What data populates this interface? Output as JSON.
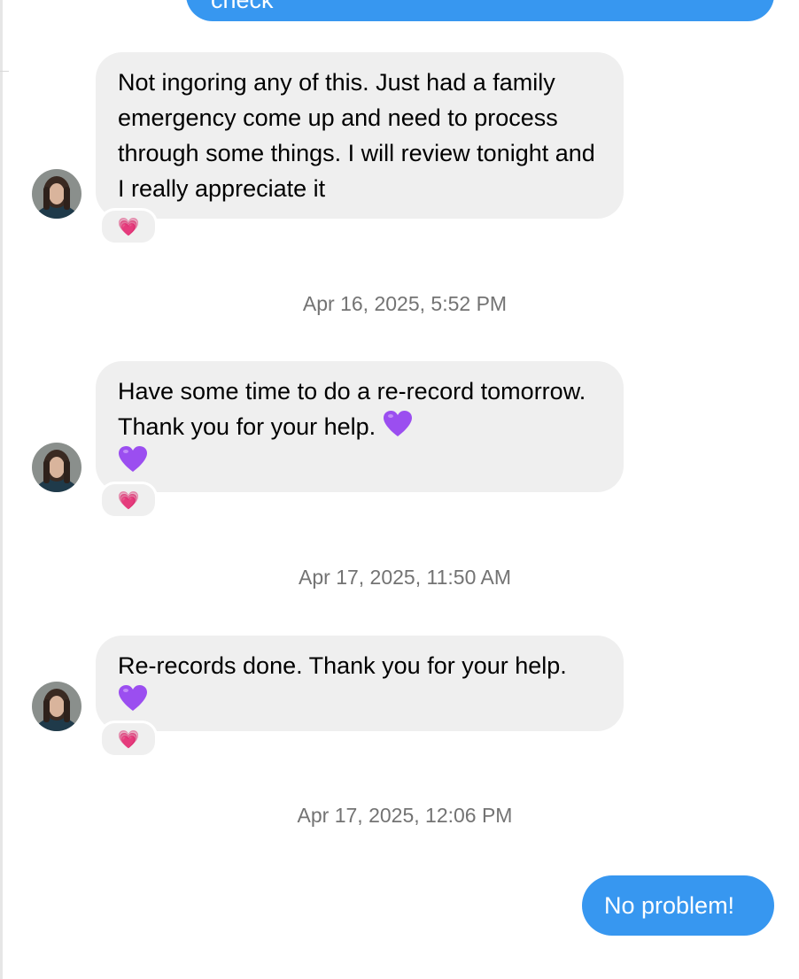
{
  "thread": {
    "top_outgoing_partial": "check",
    "messages": [
      {
        "text": "Not ingoring any of this. Just had a family emergency come up and need to process through some things. I will review tonight and I really appreciate it",
        "reaction": "💗"
      },
      {
        "timestamp": "Apr 16, 2025, 5:52 PM",
        "text": "Have some time to do a re-record tomorrow. Thank you for your help.",
        "reaction": "💗"
      },
      {
        "timestamp": "Apr 17, 2025, 11:50 AM",
        "text": "Re-records done. Thank you for your help.",
        "reaction": "💗"
      },
      {
        "timestamp": "Apr 17, 2025, 12:06 PM",
        "outgoing_text": "No problem!"
      }
    ]
  },
  "colors": {
    "outgoing_bubble": "#3797f0",
    "incoming_bubble": "#efefef",
    "timestamp_text": "#737373",
    "purple_heart": "#9b4ef0",
    "pink_heart": "#ff4f8f"
  },
  "icons": {
    "purple_heart": "purple-heart-icon",
    "pink_heart": "sparkling-heart-icon"
  }
}
